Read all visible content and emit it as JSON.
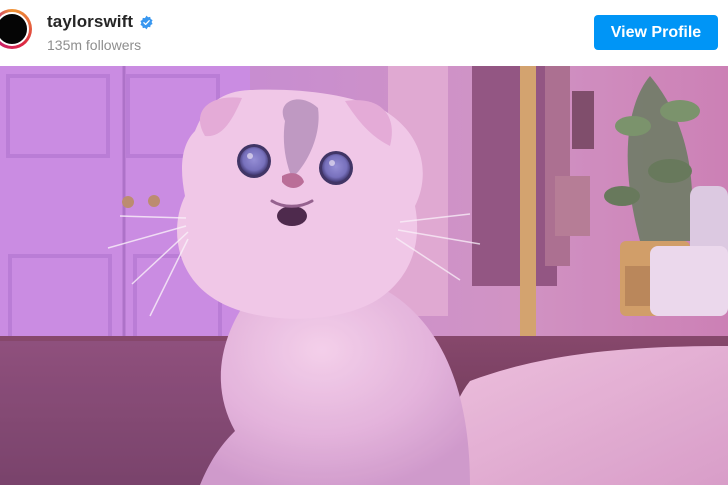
{
  "profile": {
    "username": "taylorswift",
    "followers": "135m followers",
    "verified_icon": "verified-badge-icon",
    "avatar_icon": "profile-avatar"
  },
  "actions": {
    "view_profile_label": "View Profile"
  },
  "post": {
    "image_subject": "cat-photo"
  },
  "colors": {
    "button": "#0095f6",
    "username": "#262626",
    "followers": "#8e8e8e",
    "photo_tint": "#c985c8"
  }
}
